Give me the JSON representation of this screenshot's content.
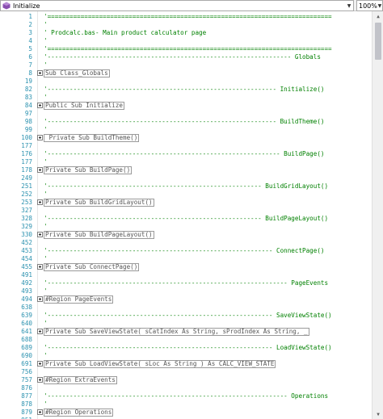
{
  "toolbar": {
    "member_dropdown": {
      "icon": "method-icon",
      "value": "Initialize"
    },
    "zoom_dropdown": {
      "value": "100%"
    }
  },
  "editor": {
    "lines": [
      {
        "num": "1",
        "kind": "comment",
        "text": "'============================================================================="
      },
      {
        "num": "2",
        "kind": "comment",
        "text": "'"
      },
      {
        "num": "3",
        "kind": "comment",
        "text": "' Prodcalc.bas- Main product calculator page"
      },
      {
        "num": "4",
        "kind": "comment",
        "text": "'"
      },
      {
        "num": "5",
        "kind": "comment",
        "text": "'============================================================================="
      },
      {
        "num": "6",
        "kind": "comment",
        "text": "'------------------------------------------------------------------ Globals"
      },
      {
        "num": "7",
        "kind": "comment",
        "text": "'"
      },
      {
        "num": "8",
        "kind": "collapsed",
        "text": "Sub Class_Globals"
      },
      {
        "num": "19",
        "kind": "blank",
        "text": ""
      },
      {
        "num": "82",
        "kind": "comment",
        "text": "'-------------------------------------------------------------- Initialize()"
      },
      {
        "num": "83",
        "kind": "comment",
        "text": "'"
      },
      {
        "num": "84",
        "kind": "collapsed",
        "text": "Public Sub Initialize"
      },
      {
        "num": "97",
        "kind": "blank",
        "text": ""
      },
      {
        "num": "98",
        "kind": "comment",
        "text": "'-------------------------------------------------------------- BuildTheme()"
      },
      {
        "num": "99",
        "kind": "comment",
        "text": "'"
      },
      {
        "num": "100",
        "kind": "collapsed",
        "text": " Private Sub BuildTheme()"
      },
      {
        "num": "177",
        "kind": "blank",
        "text": ""
      },
      {
        "num": "176",
        "kind": "comment",
        "text": "'--------------------------------------------------------------- BuildPage()"
      },
      {
        "num": "177",
        "kind": "comment",
        "text": "'"
      },
      {
        "num": "178",
        "kind": "collapsed",
        "text": "Private Sub BuildPage()"
      },
      {
        "num": "249",
        "kind": "blank",
        "text": ""
      },
      {
        "num": "251",
        "kind": "comment",
        "text": "'---------------------------------------------------------- BuildGridLayout()"
      },
      {
        "num": "252",
        "kind": "comment",
        "text": "'"
      },
      {
        "num": "253",
        "kind": "collapsed",
        "text": "Private Sub BuildGridLayout()"
      },
      {
        "num": "327",
        "kind": "blank",
        "text": ""
      },
      {
        "num": "328",
        "kind": "comment",
        "text": "'---------------------------------------------------------- BuildPageLayout()"
      },
      {
        "num": "329",
        "kind": "comment",
        "text": "'"
      },
      {
        "num": "330",
        "kind": "collapsed",
        "text": "Private Sub BuildPageLayout()"
      },
      {
        "num": "452",
        "kind": "blank",
        "text": ""
      },
      {
        "num": "453",
        "kind": "comment",
        "text": "'------------------------------------------------------------- ConnectPage()"
      },
      {
        "num": "454",
        "kind": "comment",
        "text": "'"
      },
      {
        "num": "455",
        "kind": "collapsed",
        "text": "Private Sub ConnectPage()"
      },
      {
        "num": "491",
        "kind": "blank",
        "text": ""
      },
      {
        "num": "492",
        "kind": "comment",
        "text": "'----------------------------------------------------------------- PageEvents"
      },
      {
        "num": "493",
        "kind": "comment",
        "text": "'"
      },
      {
        "num": "494",
        "kind": "collapsed",
        "text": "#Region PageEvents"
      },
      {
        "num": "638",
        "kind": "blank",
        "text": ""
      },
      {
        "num": "639",
        "kind": "comment",
        "text": "'------------------------------------------------------------- SaveViewState()"
      },
      {
        "num": "640",
        "kind": "comment",
        "text": "'"
      },
      {
        "num": "641",
        "kind": "collapsed",
        "text": "Private Sub SaveViewState( sCatIndex As String, sProdIndex As String, _"
      },
      {
        "num": "688",
        "kind": "blank",
        "text": ""
      },
      {
        "num": "689",
        "kind": "comment",
        "text": "'------------------------------------------------------------- LoadViewState()"
      },
      {
        "num": "690",
        "kind": "comment",
        "text": "'"
      },
      {
        "num": "691",
        "kind": "collapsed",
        "text": "Private Sub LoadViewState( sLoc As String ) As CALC_VIEW_STATE"
      },
      {
        "num": "756",
        "kind": "blank",
        "text": ""
      },
      {
        "num": "757",
        "kind": "collapsed",
        "text": "#Region ExtraEvents"
      },
      {
        "num": "876",
        "kind": "blank",
        "text": ""
      },
      {
        "num": "877",
        "kind": "comment",
        "text": "'----------------------------------------------------------------- Operations"
      },
      {
        "num": "878",
        "kind": "comment",
        "text": "'"
      },
      {
        "num": "879",
        "kind": "collapsed",
        "text": "#Region Operations"
      },
      {
        "num": "951",
        "kind": "blank",
        "text": ""
      }
    ]
  }
}
